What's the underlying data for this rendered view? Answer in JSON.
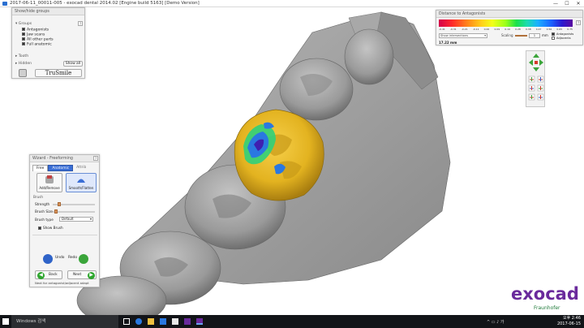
{
  "window": {
    "title": "2017-06-11_00011-005 - exocad dental 2014.02 [Engine build 5163] [Demo Version]",
    "minimize": "—",
    "maximize": "☐",
    "close": "✕"
  },
  "show_hide_groups": {
    "title": "Show/hide groups",
    "groups_label": "Groups",
    "items": [
      {
        "label": "Antagonists",
        "checked": true
      },
      {
        "label": "Jaw scans",
        "checked": true
      },
      {
        "label": "All other parts",
        "checked": true
      },
      {
        "label": "Full anatomic",
        "checked": true
      }
    ],
    "tooth_label": "Tooth",
    "hidden_label": "Hidden",
    "show_all": "Show all",
    "trusmile": "TruSmile",
    "help": "?"
  },
  "distance_panel": {
    "title": "Distance to Antagonists",
    "scale_labels": [
      "-0.41",
      "-0.31",
      "-0.21",
      "-0.11",
      "0.00",
      "0.09",
      "0.19",
      "0.28",
      "0.38",
      "0.47",
      "0.56",
      "0.65",
      "0.75"
    ],
    "dropdown": "Show intersections",
    "scaling_label": "Scaling",
    "scaling_value": "1",
    "unit": "mm",
    "antagonists": "Antagonists",
    "adjacents": "Adjacents",
    "value": "17.22 mm",
    "help": "?"
  },
  "wizard": {
    "title": "Wizard - Freeforming",
    "tabs": [
      "Free",
      "Anatomic",
      "Attrib"
    ],
    "tools": [
      "Add/Remove",
      "Smooth/Flatten"
    ],
    "brush_section": "Brush",
    "strength_label": "Strength",
    "brush_size_label": "Brush Size",
    "brush_type_label": "Brush type",
    "brush_type_value": "Default",
    "show_brush": "Show Brush",
    "undo": "Undo",
    "redo": "Redo",
    "back": "Back",
    "next": "Next",
    "hint": "Next for antagonist/adjacent adapt",
    "help": "?"
  },
  "brand": {
    "name": "exocad",
    "sub": "Fraunhofer"
  },
  "taskbar": {
    "search_placeholder": "Windows 검색",
    "time": "오후 2:46",
    "date": "2017-06-15"
  },
  "colors": {
    "crown": "#e3b320",
    "model": "#9b9b9b",
    "accent": "#3b6fd6",
    "brand": "#6a2a9c"
  }
}
